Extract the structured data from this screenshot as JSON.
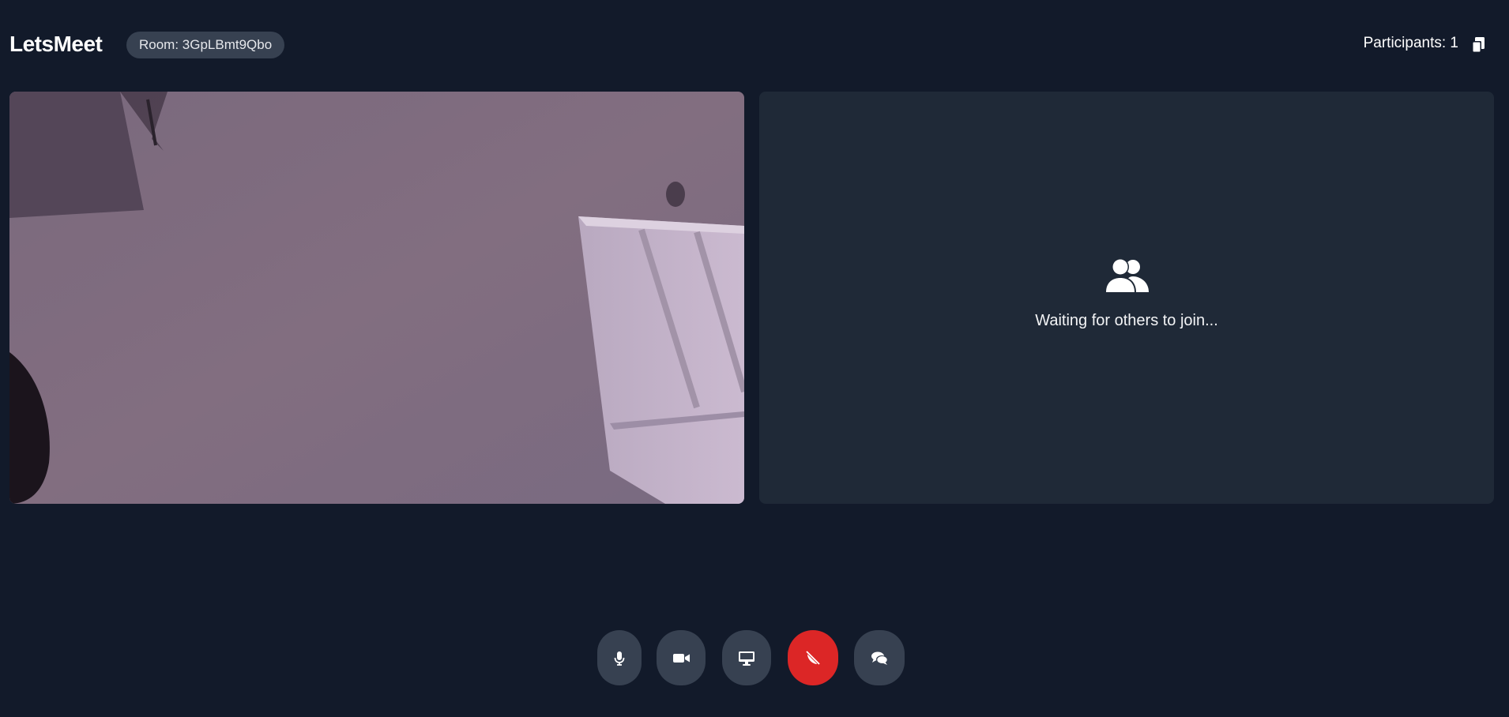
{
  "header": {
    "brand": "LetsMeet",
    "room_label": "Room: 3GpLBmt9Qbo",
    "participants_label": "Participants: 1",
    "copy_icon": "copy-icon"
  },
  "remote_tile": {
    "waiting_icon": "users-icon",
    "waiting_text": "Waiting for others to join..."
  },
  "controls": [
    {
      "name": "microphone",
      "icon": "microphone-icon"
    },
    {
      "name": "camera",
      "icon": "video-camera-icon"
    },
    {
      "name": "screen-share",
      "icon": "desktop-icon"
    },
    {
      "name": "end-call",
      "icon": "phone-slash-icon"
    },
    {
      "name": "chat",
      "icon": "chat-bubbles-icon"
    }
  ],
  "colors": {
    "background": "#121a2a",
    "tile_background": "#1f2937",
    "button_background": "#374151",
    "end_call": "#dc2626"
  }
}
